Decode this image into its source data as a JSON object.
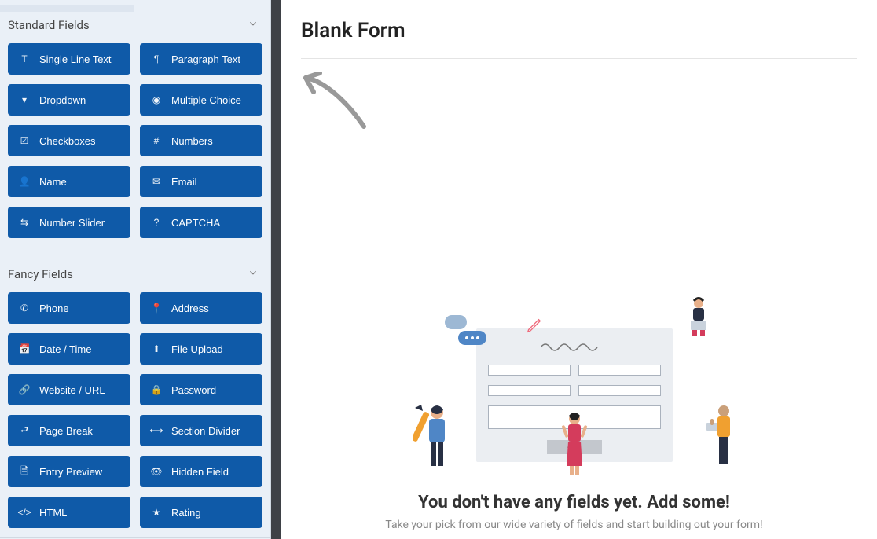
{
  "sidebar": {
    "sections": [
      {
        "title": "Standard Fields",
        "fields": [
          {
            "label": "Single Line Text",
            "icon": "text-icon"
          },
          {
            "label": "Paragraph Text",
            "icon": "paragraph-icon"
          },
          {
            "label": "Dropdown",
            "icon": "dropdown-icon"
          },
          {
            "label": "Multiple Choice",
            "icon": "radio-icon"
          },
          {
            "label": "Checkboxes",
            "icon": "checkbox-icon"
          },
          {
            "label": "Numbers",
            "icon": "hash-icon"
          },
          {
            "label": "Name",
            "icon": "user-icon"
          },
          {
            "label": "Email",
            "icon": "envelope-icon"
          },
          {
            "label": "Number Slider",
            "icon": "slider-icon"
          },
          {
            "label": "CAPTCHA",
            "icon": "captcha-icon"
          }
        ]
      },
      {
        "title": "Fancy Fields",
        "fields": [
          {
            "label": "Phone",
            "icon": "phone-icon"
          },
          {
            "label": "Address",
            "icon": "pin-icon"
          },
          {
            "label": "Date / Time",
            "icon": "calendar-icon"
          },
          {
            "label": "File Upload",
            "icon": "upload-icon"
          },
          {
            "label": "Website / URL",
            "icon": "link-icon"
          },
          {
            "label": "Password",
            "icon": "lock-icon"
          },
          {
            "label": "Page Break",
            "icon": "pagebreak-icon"
          },
          {
            "label": "Section Divider",
            "icon": "divider-icon"
          },
          {
            "label": "Entry Preview",
            "icon": "preview-icon"
          },
          {
            "label": "Hidden Field",
            "icon": "eye-icon"
          },
          {
            "label": "HTML",
            "icon": "code-icon"
          },
          {
            "label": "Rating",
            "icon": "star-icon"
          }
        ]
      }
    ]
  },
  "main": {
    "title": "Blank Form",
    "empty_heading": "You don't have any fields yet. Add some!",
    "empty_sub": "Take your pick from our wide variety of fields and start building out your form!"
  },
  "icons": {
    "text-icon": "T",
    "paragraph-icon": "¶",
    "dropdown-icon": "▾",
    "radio-icon": "◉",
    "checkbox-icon": "☑",
    "hash-icon": "#",
    "user-icon": "👤",
    "envelope-icon": "✉",
    "slider-icon": "⇆",
    "captcha-icon": "?",
    "phone-icon": "✆",
    "pin-icon": "📍",
    "calendar-icon": "📅",
    "upload-icon": "⬆",
    "link-icon": "🔗",
    "lock-icon": "🔒",
    "pagebreak-icon": "⮐",
    "divider-icon": "⟷",
    "preview-icon": "🗎",
    "eye-icon": "👁",
    "code-icon": "</>",
    "star-icon": "★"
  }
}
